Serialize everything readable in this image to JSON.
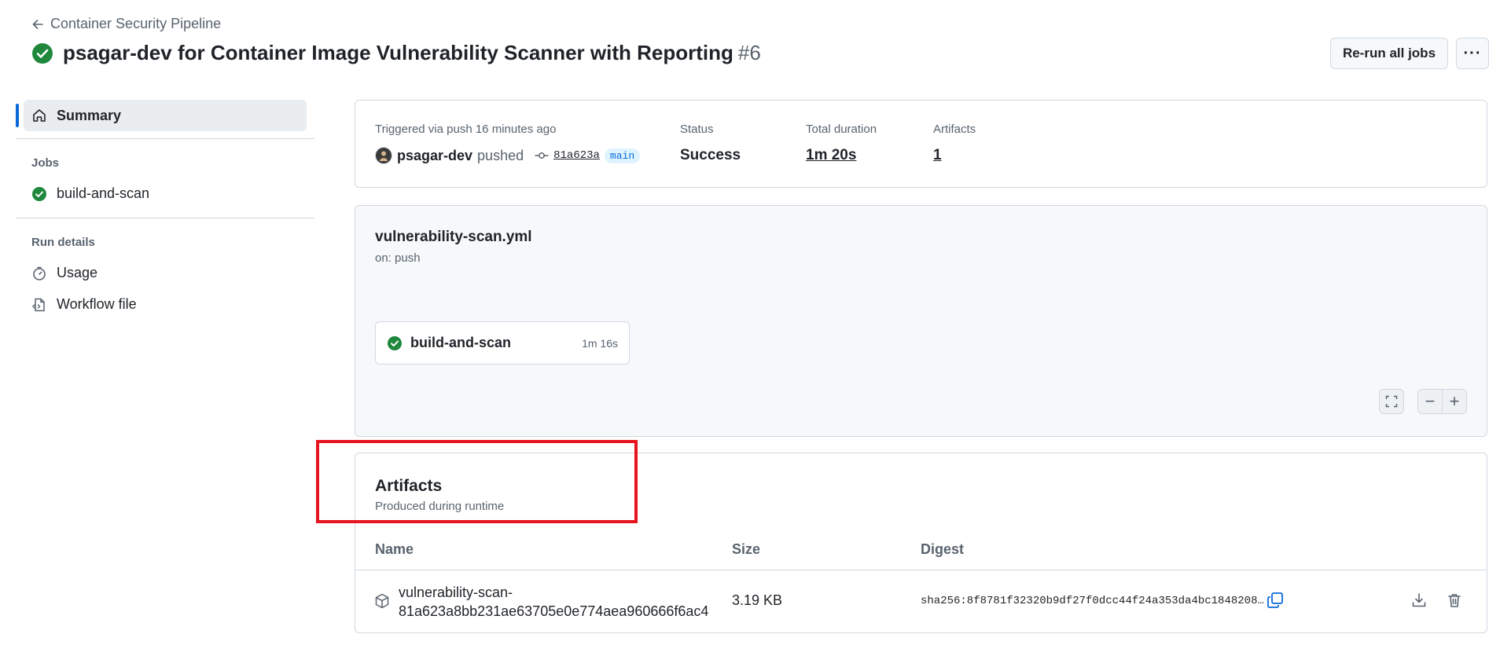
{
  "header": {
    "back_label": "Container Security Pipeline",
    "title": "psagar-dev for Container Image Vulnerability Scanner with Reporting",
    "run_number": "#6",
    "rerun_label": "Re-run all jobs",
    "more_label": "···"
  },
  "sidebar": {
    "summary_label": "Summary",
    "jobs_heading": "Jobs",
    "jobs": [
      {
        "label": "build-and-scan",
        "status": "success"
      }
    ],
    "run_details_heading": "Run details",
    "usage_label": "Usage",
    "workflow_file_label": "Workflow file"
  },
  "summary": {
    "trigger_label": "Triggered via push 16 minutes ago",
    "actor": "psagar-dev",
    "action": "pushed",
    "commit": "81a623a",
    "branch": "main",
    "status_label": "Status",
    "status_value": "Success",
    "duration_label": "Total duration",
    "duration_value": "1m 20s",
    "artifacts_label": "Artifacts",
    "artifacts_value": "1"
  },
  "workflow": {
    "file": "vulnerability-scan.yml",
    "trigger": "on: push",
    "job_name": "build-and-scan",
    "job_duration": "1m 16s",
    "zoom_minus": "−",
    "zoom_plus": "+"
  },
  "artifacts": {
    "title": "Artifacts",
    "subtitle": "Produced during runtime",
    "columns": {
      "name": "Name",
      "size": "Size",
      "digest": "Digest"
    },
    "rows": [
      {
        "name_line1": "vulnerability-scan-",
        "name_line2": "81a623a8bb231ae63705e0e774aea960666f6ac4",
        "size": "3.19 KB",
        "digest": "sha256:8f8781f32320b9df27f0dcc44f24a353da4bc1848208…"
      }
    ]
  },
  "colors": {
    "success": "#1f883d",
    "accent": "#0969da",
    "highlight_box": "#e5141d"
  }
}
